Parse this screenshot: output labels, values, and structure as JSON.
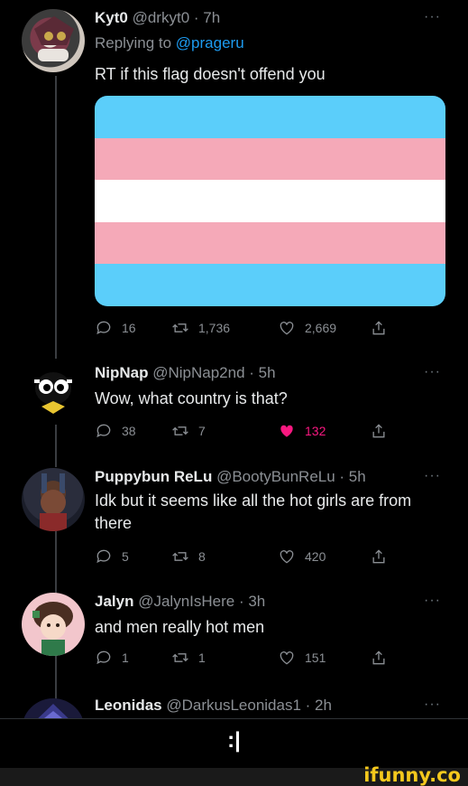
{
  "tweets": [
    {
      "name": "Kyt0",
      "handle": "@drkyt0",
      "time": "· 7h",
      "reply_label": "Replying to",
      "reply_handle": "@prageru",
      "text": "RT if this flag doesn't offend you",
      "replies": "16",
      "retweets": "1,736",
      "likes": "2,669",
      "more": "···"
    },
    {
      "name": "NipNap",
      "handle": "@NipNap2nd",
      "time": "· 5h",
      "text": "Wow, what country is that?",
      "replies": "38",
      "retweets": "7",
      "likes": "132",
      "more": "···"
    },
    {
      "name": "Puppybun ReLu",
      "handle": "@BootyBunReLu",
      "time": "· 5h",
      "text": "Idk but it seems like all the hot girls are from there",
      "replies": "5",
      "retweets": "8",
      "likes": "420",
      "more": "···"
    },
    {
      "name": "Jalyn",
      "handle": "@JalynIsHere",
      "time": "· 3h",
      "text": "and men really hot men",
      "replies": "1",
      "retweets": "1",
      "likes": "151",
      "more": "···"
    },
    {
      "name": "Leonidas",
      "handle": "@DarkusLeonidas1",
      "time": "· 2h",
      "more": "···"
    }
  ],
  "flag": {
    "colors": [
      "#5bcefa",
      "#f5a9b8",
      "#ffffff",
      "#f5a9b8",
      "#5bcefa"
    ]
  },
  "caption": ":|",
  "watermark": "ifunny.co"
}
